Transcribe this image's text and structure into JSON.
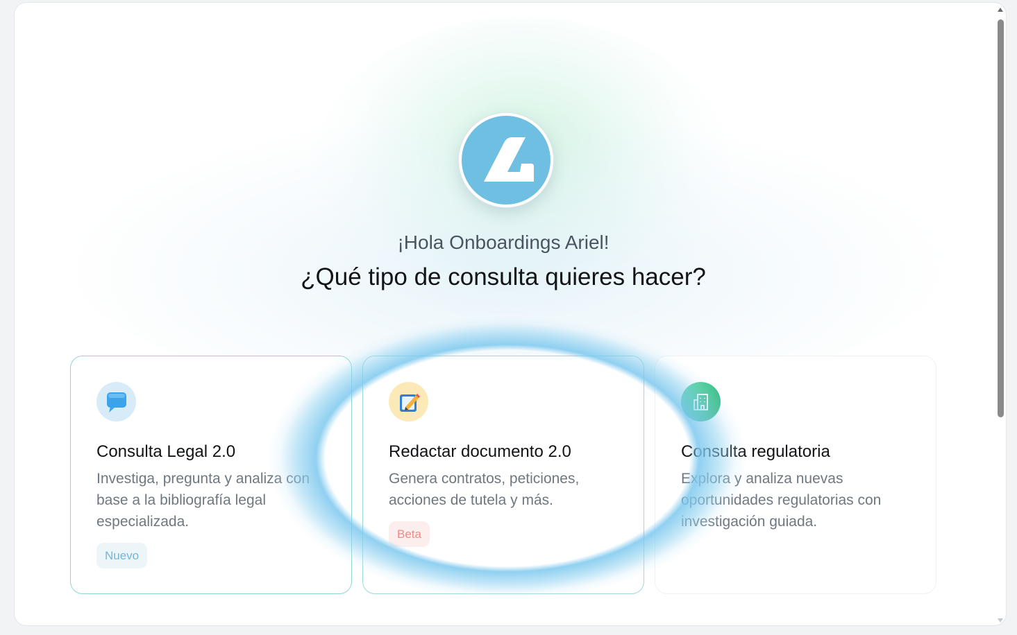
{
  "greeting": "¡Hola Onboardings Ariel!",
  "question": "¿Qué tipo de consulta quieres hacer?",
  "logo": {
    "icon": "brand-logo-icon",
    "color": "#6fbfe3"
  },
  "cards": [
    {
      "title": "Consulta Legal 2.0",
      "description": "Investiga, pregunta y analiza con base a la bibliografía legal especializada.",
      "badge": "Nuevo",
      "icon": "speech-bubble-icon"
    },
    {
      "title": "Redactar documento 2.0",
      "description": "Genera contratos, peticiones, acciones de tutela y más.",
      "badge": "Beta",
      "icon": "memo-pencil-icon"
    },
    {
      "title": "Consulta regulatoria",
      "description": "Explora y analiza nuevas oportunidades regulatorias con investigación guiada.",
      "icon": "building-icon"
    }
  ],
  "colors": {
    "accent": "#6fbfe3",
    "badge_new": "#77b4d6",
    "badge_beta": "#ef8b86",
    "regulatory_icon": "#2fb37e"
  }
}
